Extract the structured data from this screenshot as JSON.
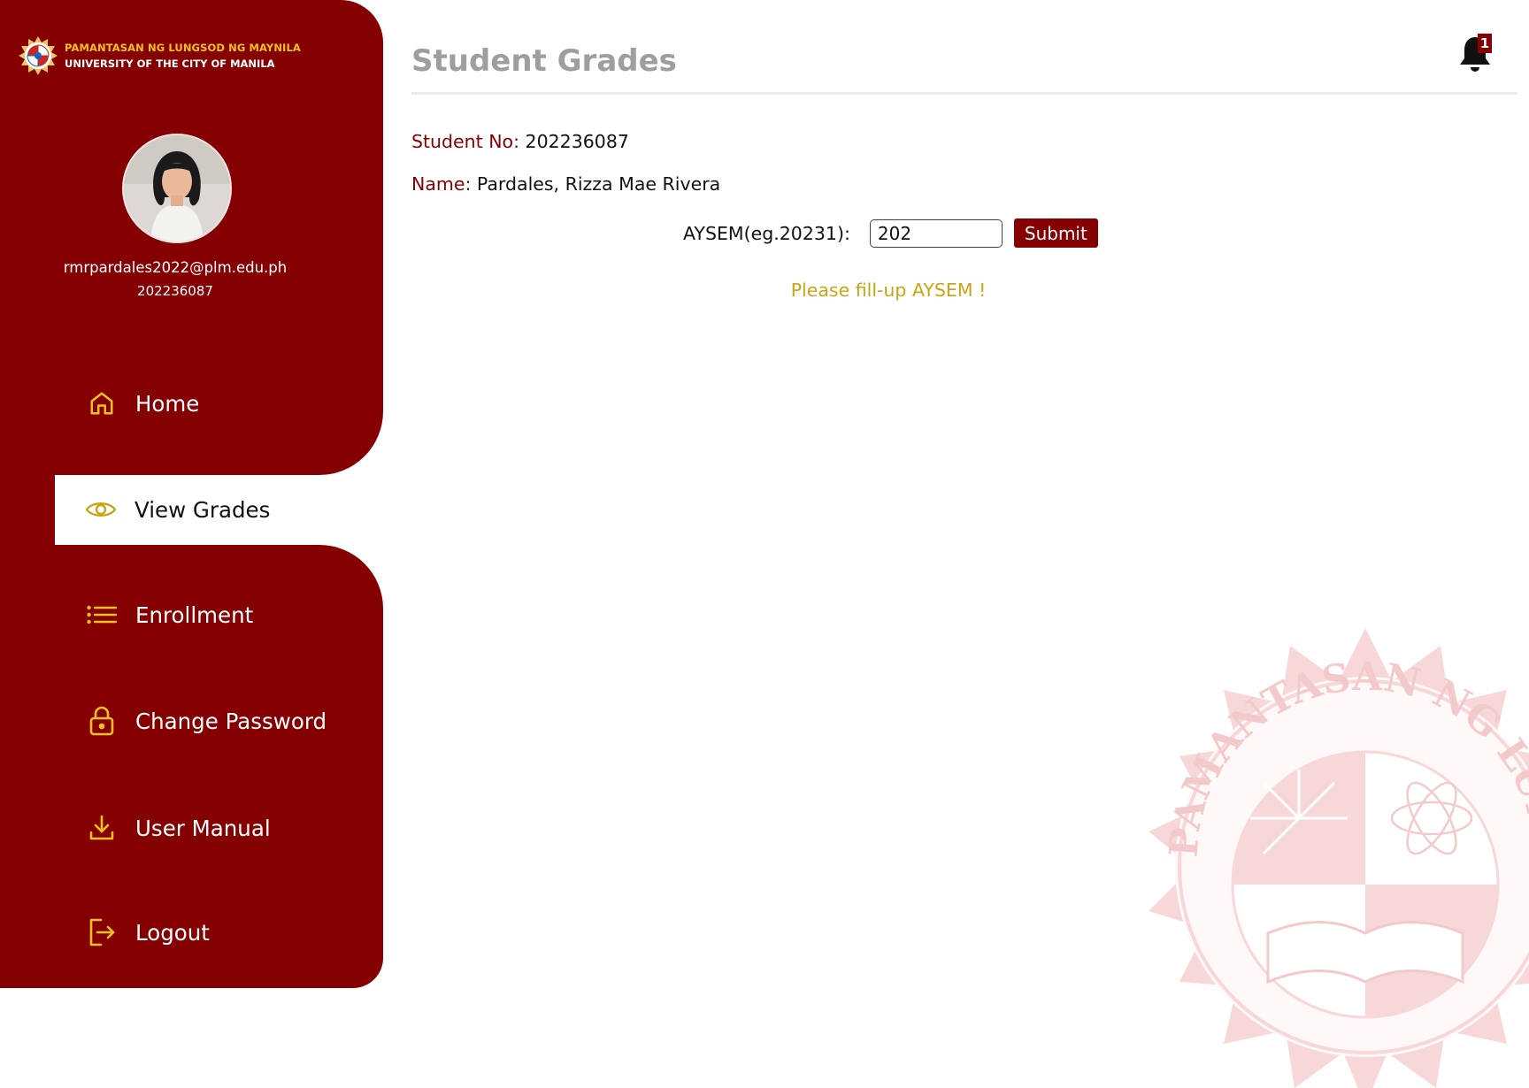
{
  "brand": {
    "line1": "PAMANTASAN NG LUNGSOD NG MAYNILA",
    "line2": "UNIVERSITY OF THE CITY OF MANILA"
  },
  "user": {
    "email": "rmrpardales2022@plm.edu.ph",
    "id": "202236087"
  },
  "sidebar": {
    "items": [
      {
        "label": "Home",
        "icon": "home-icon"
      },
      {
        "label": "View Grades",
        "icon": "eye-icon",
        "active": true
      },
      {
        "label": "Enrollment",
        "icon": "list-icon"
      },
      {
        "label": "Change Password",
        "icon": "lock-icon"
      },
      {
        "label": "User Manual",
        "icon": "download-icon"
      },
      {
        "label": "Logout",
        "icon": "logout-icon"
      }
    ]
  },
  "header": {
    "title": "Student Grades",
    "notification_count": "1"
  },
  "student": {
    "no_label": "Student No:",
    "no_value": "202236087",
    "name_label": "Name:",
    "name_value": "Pardales, Rizza Mae Rivera"
  },
  "form": {
    "aysem_label": "AYSEM(eg.20231):",
    "aysem_value": "202",
    "submit_label": "Submit",
    "warning": "Please fill-up AYSEM !"
  },
  "watermark": {
    "text": "PAMANTASAN NG LUNGSOD NG MAYNILA"
  },
  "colors": {
    "primary": "#850000",
    "accent": "#f2c21a",
    "warning": "#c9a514",
    "title_gray": "#9e9e9e"
  }
}
